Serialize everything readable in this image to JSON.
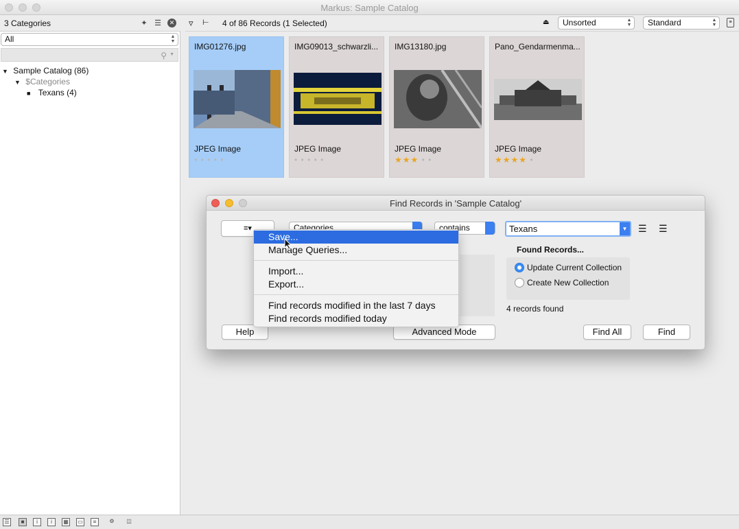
{
  "window": {
    "title": "Markus: Sample Catalog"
  },
  "left_panel": {
    "count_label": "3 Categories",
    "filter_value": "All",
    "tree": [
      {
        "label": "Sample Catalog (86)"
      },
      {
        "label": "$Categories"
      },
      {
        "label": "Texans (4)"
      }
    ]
  },
  "toolbar": {
    "records_label": "4 of 86 Records (1 Selected)",
    "sort_value": "Unsorted",
    "view_value": "Standard"
  },
  "thumbnails": [
    {
      "filename": "IMG01276.jpg",
      "type": "JPEG Image",
      "rating": 0
    },
    {
      "filename": "IMG09013_schwarzli...",
      "type": "JPEG Image",
      "rating": 0
    },
    {
      "filename": "IMG13180.jpg",
      "type": "JPEG Image",
      "rating": 3
    },
    {
      "filename": "Pano_Gendarmenma...",
      "type": "JPEG Image",
      "rating": 4
    }
  ],
  "dialog": {
    "title": "Find Records in 'Sample Catalog'",
    "field_value": "Categories",
    "operator_value": "contains",
    "search_value": "Texans",
    "found_heading": "Found Records...",
    "options": [
      "Update Current Collection",
      "Create New Collection"
    ],
    "selected_option": "Update Current Collection",
    "result_text": "4 records found",
    "help_label": "Help",
    "advanced_label": "Advanced Mode",
    "find_all_label": "Find All",
    "find_label": "Find"
  },
  "menu": {
    "items": [
      "Save...",
      "Manage Queries...",
      "Import...",
      "Export...",
      "Find records modified in the last 7 days",
      "Find records modified today"
    ],
    "highlighted": "Save..."
  },
  "colors": {
    "selection": "#a5cdf8",
    "menu_highlight": "#2c6ce0",
    "star": "#e9a521",
    "close_light": "#ee5f57",
    "min_light": "#f5bd2f",
    "zoom_light": "#c8c8c8"
  }
}
